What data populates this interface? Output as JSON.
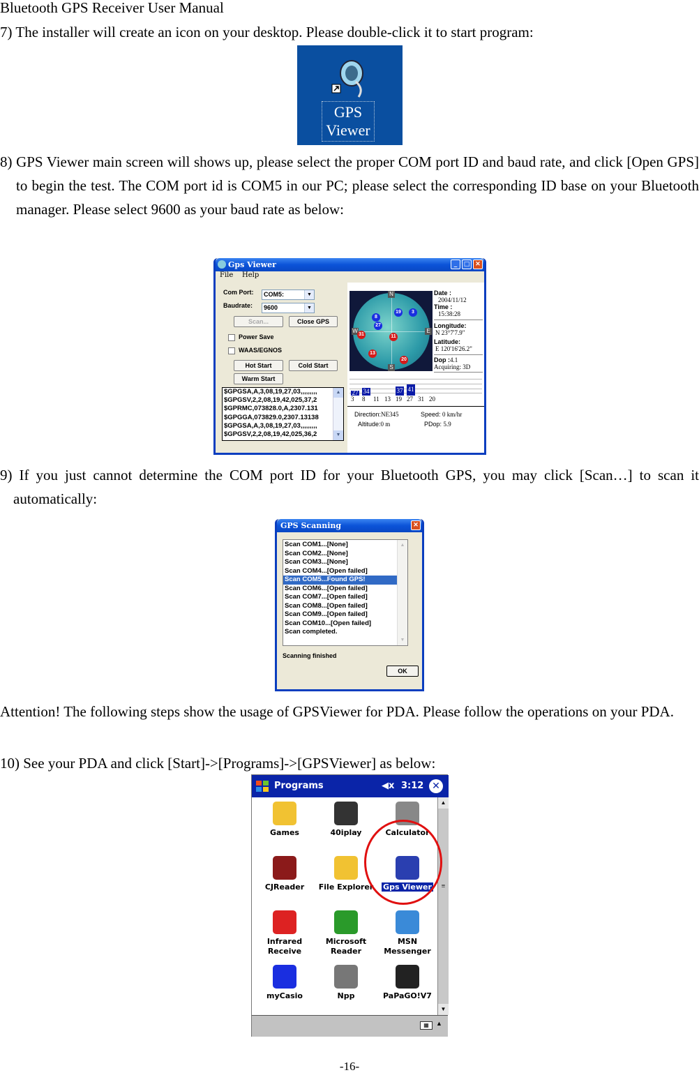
{
  "header": {
    "title": "Bluetooth GPS Receiver User Manual"
  },
  "steps": {
    "step7": "7) The installer will create an icon on your desktop. Please double-click it to start program:",
    "step8": "8) GPS Viewer main screen will shows up, please select the proper COM port ID and baud rate, and click [Open GPS] to begin the test. The COM port id is COM5 in our PC; please select the corresponding ID base on your Bluetooth manager. Please select 9600 as your baud rate as below:",
    "step9": "9) If you just cannot determine the COM port ID for your Bluetooth GPS, you may click [Scan…] to scan it automatically:",
    "attention": "Attention! The following steps show the usage of GPSViewer for PDA. Please follow the operations on your PDA.",
    "step10": "10) See your PDA and click [Start]->[Programs]->[GPSViewer] as below:"
  },
  "desktop_icon": {
    "label_line1": "GPS",
    "label_line2": "Viewer",
    "icon": "gps-device-shortcut-icon"
  },
  "gps_viewer": {
    "title": "Gps Viewer",
    "menu": [
      "File",
      "Help"
    ],
    "com_port_label": "Com Port:",
    "com_port_value": "COM5:",
    "baudrate_label": "Baudrate:",
    "baudrate_value": "9600",
    "scan_button": "Scan...",
    "close_gps_button": "Close GPS",
    "power_save": "Power Save",
    "waas": "WAAS/EGNOS",
    "hot_start": "Hot Start",
    "cold_start": "Cold Start",
    "warm_start": "Warm Start",
    "nmea_log": [
      "$GPGSA,A,3,08,19,27,03,,,,,,,,,",
      "$GPGSV,2,2,08,19,42,025,37,2",
      "$GPRMC,073828.0,A,2307.131",
      "$GPGGA,073829.0,2307.13138",
      "$GPGSA,A,3,08,19,27,03,,,,,,,,,",
      "$GPGSV,2,2,08,19,42,025,36,2"
    ],
    "compass": {
      "n": "N",
      "s": "S",
      "e": "E",
      "w": "W"
    },
    "satellites": [
      {
        "id": "8",
        "color": "blue"
      },
      {
        "id": "19",
        "color": "blue"
      },
      {
        "id": "3",
        "color": "blue"
      },
      {
        "id": "27",
        "color": "blue"
      },
      {
        "id": "31",
        "color": "red"
      },
      {
        "id": "11",
        "color": "red"
      },
      {
        "id": "13",
        "color": "red"
      },
      {
        "id": "20",
        "color": "red"
      }
    ],
    "date_label": "Date :",
    "date_value": "2004/11/12",
    "time_label": "Time :",
    "time_value": "15:38:28",
    "longitude_label": "Longitude:",
    "longitude_value": "N  23°7'7.9\"",
    "latitude_label": "Latitude:",
    "latitude_value": "E 120'16'26.2\"",
    "dop_label": "Dop :",
    "dop_value": "4.1",
    "acquiring": "Acquiring: 3D",
    "signal_bars": [
      {
        "sat": "3",
        "snr": "27"
      },
      {
        "sat": "8",
        "snr": "34"
      },
      {
        "sat": "11",
        "snr": ""
      },
      {
        "sat": "13",
        "snr": ""
      },
      {
        "sat": "19",
        "snr": "37"
      },
      {
        "sat": "27",
        "snr": "41"
      },
      {
        "sat": "31",
        "snr": ""
      },
      {
        "sat": "20",
        "snr": ""
      }
    ],
    "direction_label": "Direction:",
    "direction_value": "NE345",
    "speed_label": "Speed:",
    "speed_value": "0 km/hr",
    "altitude_label": "Altitude:",
    "altitude_value": "0 m",
    "pdop_label": "PDop:",
    "pdop_value": "5.9"
  },
  "gps_scanning": {
    "title": "GPS Scanning",
    "results": [
      "Scan COM1...[None]",
      "Scan COM2...[None]",
      "Scan COM3...[None]",
      "Scan COM4...[Open failed]",
      "Scan COM5...Found GPS!",
      "Scan COM6...[Open failed]",
      "Scan COM7...[Open failed]",
      "Scan COM8...[Open failed]",
      "Scan COM9...[Open failed]",
      "Scan COM10...[Open failed]",
      "Scan completed."
    ],
    "selected_index": 4,
    "status": "Scanning finished",
    "ok_button": "OK"
  },
  "pda": {
    "title": "Programs",
    "time": "3:12",
    "programs": [
      {
        "label": "Games",
        "icon": "games-folder-icon"
      },
      {
        "label": "40iplay",
        "icon": "40iplay-icon"
      },
      {
        "label": "Calculator",
        "icon": "calculator-icon"
      },
      {
        "label": "CJReader",
        "icon": "book-icon"
      },
      {
        "label": "File Explorer",
        "icon": "file-explorer-icon"
      },
      {
        "label": "Gps Viewer",
        "icon": "gps-viewer-icon"
      },
      {
        "label": "Infrared Receive",
        "icon": "infrared-icon"
      },
      {
        "label": "Microsoft Reader",
        "icon": "reader-icon"
      },
      {
        "label": "MSN Messenger",
        "icon": "msn-icon"
      },
      {
        "label": "myCasio",
        "icon": "mycasio-icon"
      },
      {
        "label": "Npp",
        "icon": "npp-icon"
      },
      {
        "label": "PaPaGO!V7",
        "icon": "papago-icon"
      }
    ],
    "selected_program": "Gps Viewer"
  },
  "footer": {
    "page_number": "-16-"
  }
}
